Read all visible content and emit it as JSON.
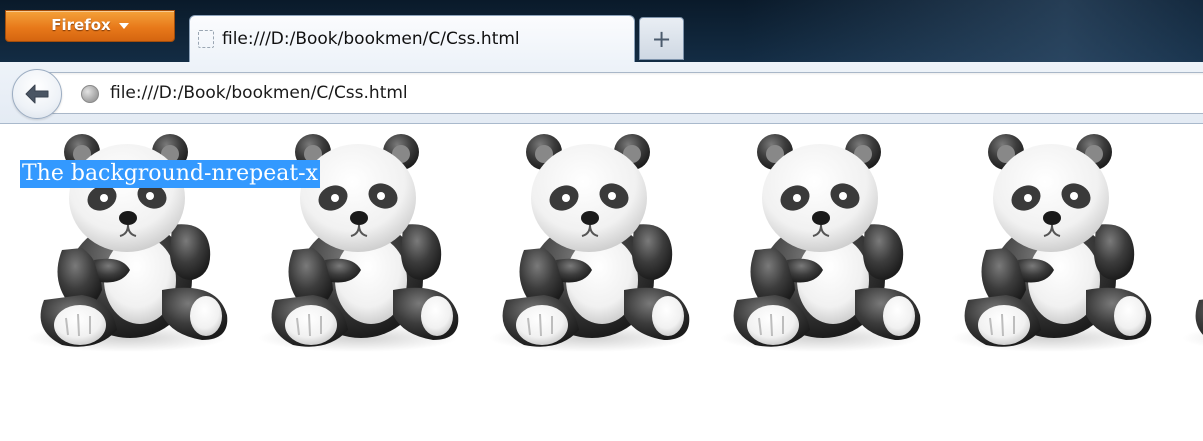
{
  "browser": {
    "menu_button": {
      "label": "Firefox",
      "icon": "chevron-down-icon"
    },
    "tabs": [
      {
        "title": "file:///D:/Book/bookmen/C/Css.html",
        "icon": "blank-page-icon",
        "active": true
      }
    ],
    "new_tab": {
      "label": "+",
      "icon": "plus-icon"
    },
    "navbar": {
      "back_icon": "back-arrow-icon",
      "site_icon": "globe-icon",
      "url": "file:///D:/Book/bookmen/C/Css.html"
    }
  },
  "page": {
    "selected_text": "The background-nrepeat-x",
    "background_image": "panda-icon",
    "background_repeat": "repeat-x",
    "selection_color": "#3399ff"
  }
}
